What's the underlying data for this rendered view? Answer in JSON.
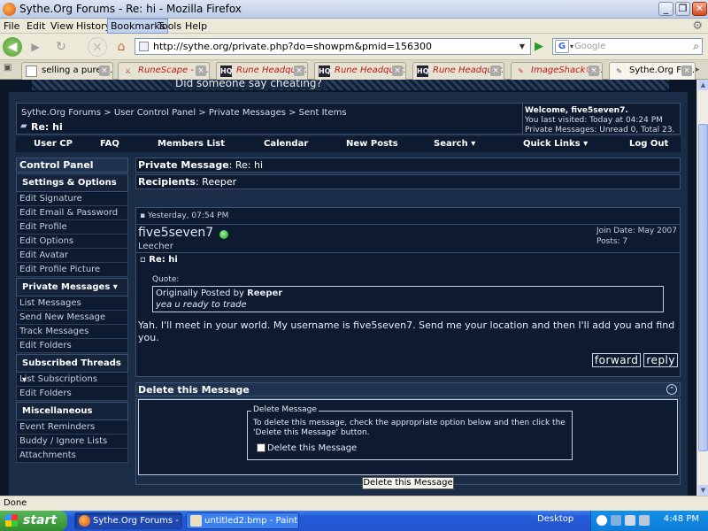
{
  "window": {
    "title": "Sythe.Org Forums - Re: hi - Mozilla Firefox"
  },
  "menu": [
    "File",
    "Edit",
    "View",
    "History",
    "Bookmarks",
    "Tools",
    "Help"
  ],
  "menu_active": "Bookmarks",
  "address": {
    "url": "http://sythe.org/private.php?do=showpm&pmid=156300"
  },
  "search": {
    "placeholder": "Google"
  },
  "tabs": [
    {
      "label": "selling a pure fi...",
      "icon": "page-icon",
      "selected": false
    },
    {
      "label": "RuneScape - th...",
      "icon": "runescape-icon",
      "selected": false,
      "red": true
    },
    {
      "label": "Rune Headquar...",
      "icon": "hq-icon",
      "selected": false,
      "red": true
    },
    {
      "label": "Rune Headquar...",
      "icon": "hq-icon",
      "selected": false,
      "red": true
    },
    {
      "label": "Rune Headquar...",
      "icon": "hq-icon",
      "selected": false,
      "red": true
    },
    {
      "label": "ImageShack® -...",
      "icon": "imageshack-icon",
      "selected": false,
      "red": true
    },
    {
      "label": "Sythe.Org Fo...",
      "icon": "sythe-icon",
      "selected": true
    }
  ],
  "banner": {
    "text": "Did someone say cheating?"
  },
  "breadcrumb": {
    "path": "Sythe.Org Forums > User Control Panel > Private Messages > Sent Items",
    "current": "Re: hi"
  },
  "welcome": {
    "line1": "Welcome, five5seven7.",
    "line2": "You last visited: Today at 04:24 PM",
    "line3": "Private Messages: Unread 0, Total 23."
  },
  "nav": [
    "User CP",
    "FAQ",
    "Members List",
    "Calendar",
    "New Posts",
    "Search ▾",
    "Quick Links ▾",
    "Log Out"
  ],
  "sidebar": {
    "control_panel": "Control Panel",
    "sections": [
      {
        "title": "Settings & Options",
        "items": [
          "Edit Signature",
          "Edit Email & Password",
          "Edit Profile",
          "Edit Options",
          "Edit Avatar",
          "Edit Profile Picture"
        ]
      },
      {
        "title": "Private Messages ▾",
        "items": [
          "List Messages",
          "Send New Message",
          "Track Messages",
          "Edit Folders"
        ]
      },
      {
        "title": "Subscribed Threads ▾",
        "items": [
          "List Subscriptions",
          "Edit Folders"
        ]
      },
      {
        "title": "Miscellaneous",
        "items": [
          "Event Reminders",
          "Buddy / Ignore Lists",
          "Attachments"
        ]
      }
    ]
  },
  "message": {
    "header_label": "Private Message",
    "header_value": "Re: hi",
    "recipients_label": "Recipients",
    "recipients_value": "Reeper",
    "date": "Yesterday, 07:54 PM",
    "username": "five5seven7",
    "rank": "Leecher",
    "join_date": "Join Date: May 2007",
    "posts": "Posts: 7",
    "title": "Re: hi",
    "quote_label": "Quote:",
    "quote_prefix": "Originally Posted by",
    "quote_author": "Reeper",
    "quote_text": "yea u ready to trade",
    "body": "Yah. I'll meet in your world. My username is five5seven7. Send me your location and then I'll add you and find you.",
    "forward": "forward",
    "reply": "reply"
  },
  "delete": {
    "header": "Delete this Message",
    "legend": "Delete Message",
    "instructions": "To delete this message, check the appropriate option below and then click the 'Delete this Message' button.",
    "checkbox_label": "Delete this Message",
    "button": "Delete this Message"
  },
  "status": "Done",
  "taskbar": {
    "start": "start",
    "tasks": [
      "Sythe.Org Forums - ...",
      "untitled2.bmp - Paint"
    ],
    "desktop": "Desktop",
    "time": "4:48 PM"
  }
}
